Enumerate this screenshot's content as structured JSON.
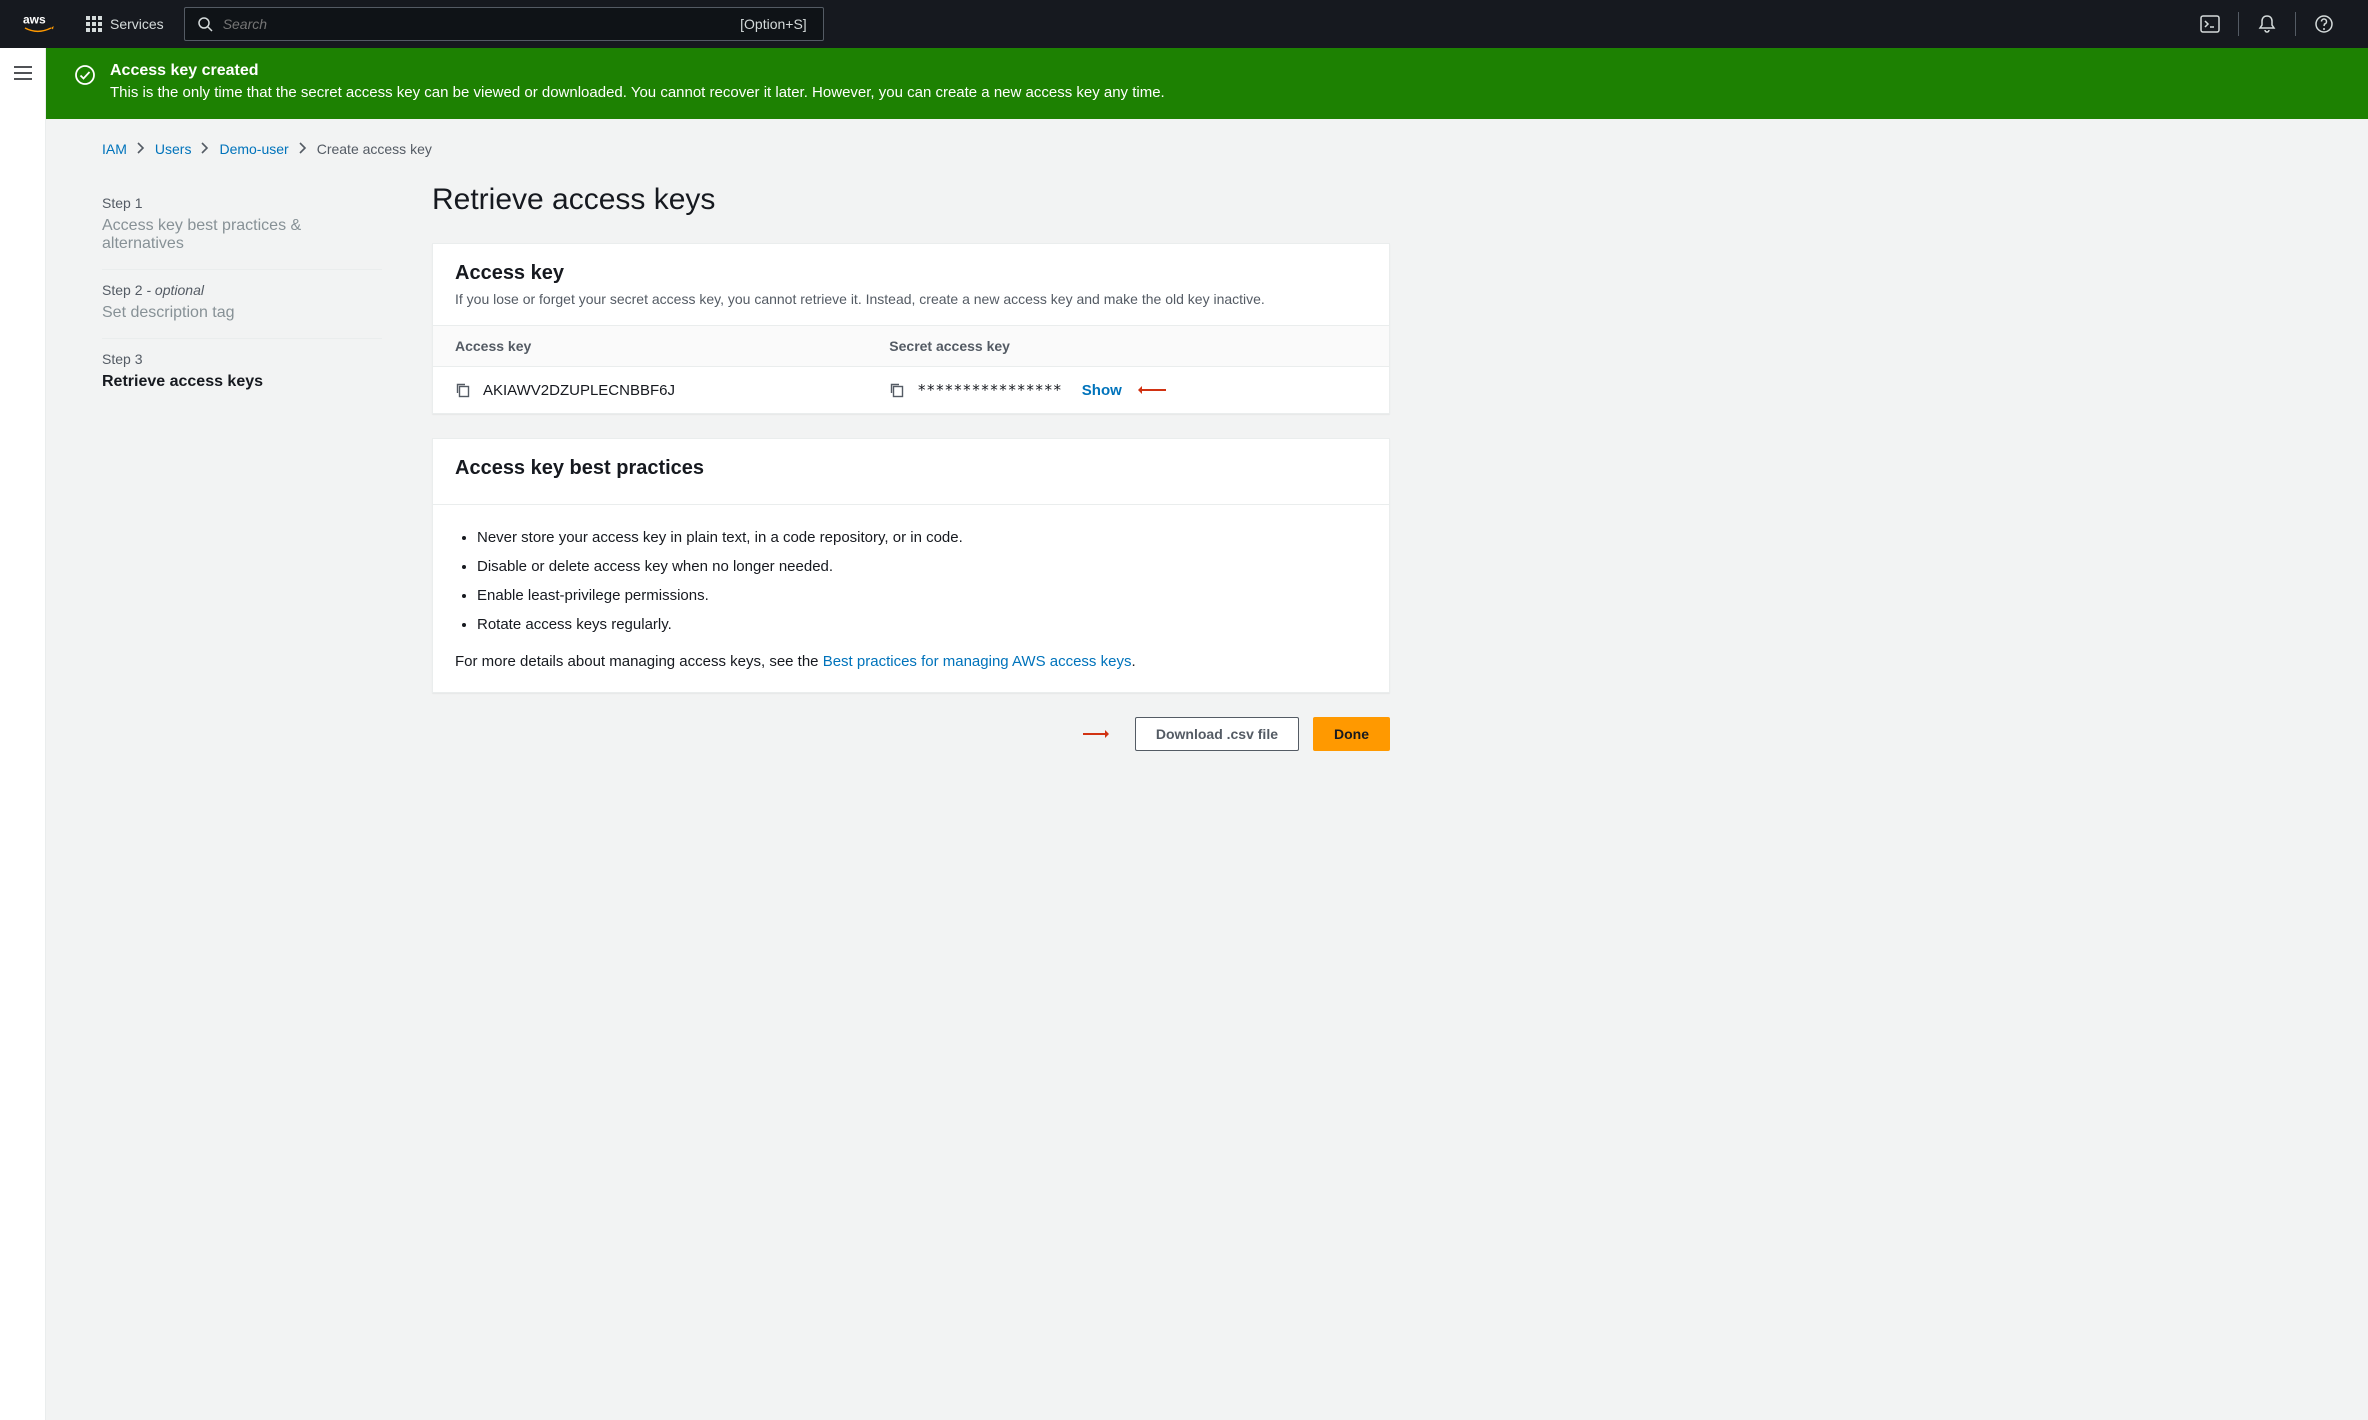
{
  "topnav": {
    "services_label": "Services",
    "search_placeholder": "Search",
    "search_shortcut": "[Option+S]"
  },
  "banner": {
    "title": "Access key created",
    "description": "This is the only time that the secret access key can be viewed or downloaded. You cannot recover it later. However, you can create a new access key any time."
  },
  "breadcrumbs": {
    "iam": "IAM",
    "users": "Users",
    "user": "Demo-user",
    "current": "Create access key"
  },
  "steps": {
    "s1_num": "Step 1",
    "s1_label": "Access key best practices & alternatives",
    "s2_num": "Step 2",
    "s2_opt": " - optional",
    "s2_label": "Set description tag",
    "s3_num": "Step 3",
    "s3_label": "Retrieve access keys"
  },
  "page": {
    "title": "Retrieve access keys"
  },
  "key_panel": {
    "heading": "Access key",
    "sub": "If you lose or forget your secret access key, you cannot retrieve it. Instead, create a new access key and make the old key inactive.",
    "col_access": "Access key",
    "col_secret": "Secret access key",
    "access_key_value": "AKIAWV2DZUPLECNBBF6J",
    "secret_masked": "****************",
    "show_label": "Show"
  },
  "bp_panel": {
    "heading": "Access key best practices",
    "items": [
      "Never store your access key in plain text, in a code repository, or in code.",
      "Disable or delete access key when no longer needed.",
      "Enable least-privilege permissions.",
      "Rotate access keys regularly."
    ],
    "foot_prefix": "For more details about managing access keys, see the ",
    "foot_link": "Best practices for managing AWS access keys",
    "foot_suffix": "."
  },
  "actions": {
    "download": "Download .csv file",
    "done": "Done"
  }
}
